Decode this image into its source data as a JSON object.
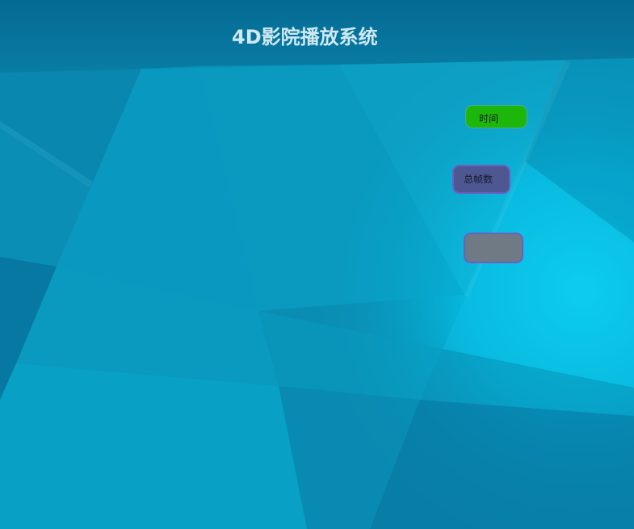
{
  "window": {
    "title": "4D影院播放系统"
  },
  "controls": {
    "time_label": "时间",
    "total_frames_label": "总帧数",
    "empty_value": ""
  },
  "colors": {
    "background": "#0a93b8",
    "title_text": "#cfe9f3",
    "time_button": "#1db70c",
    "frames_button": "#4e5791",
    "empty_field": "#6f7a84",
    "field_border": "#6a5fc2"
  }
}
